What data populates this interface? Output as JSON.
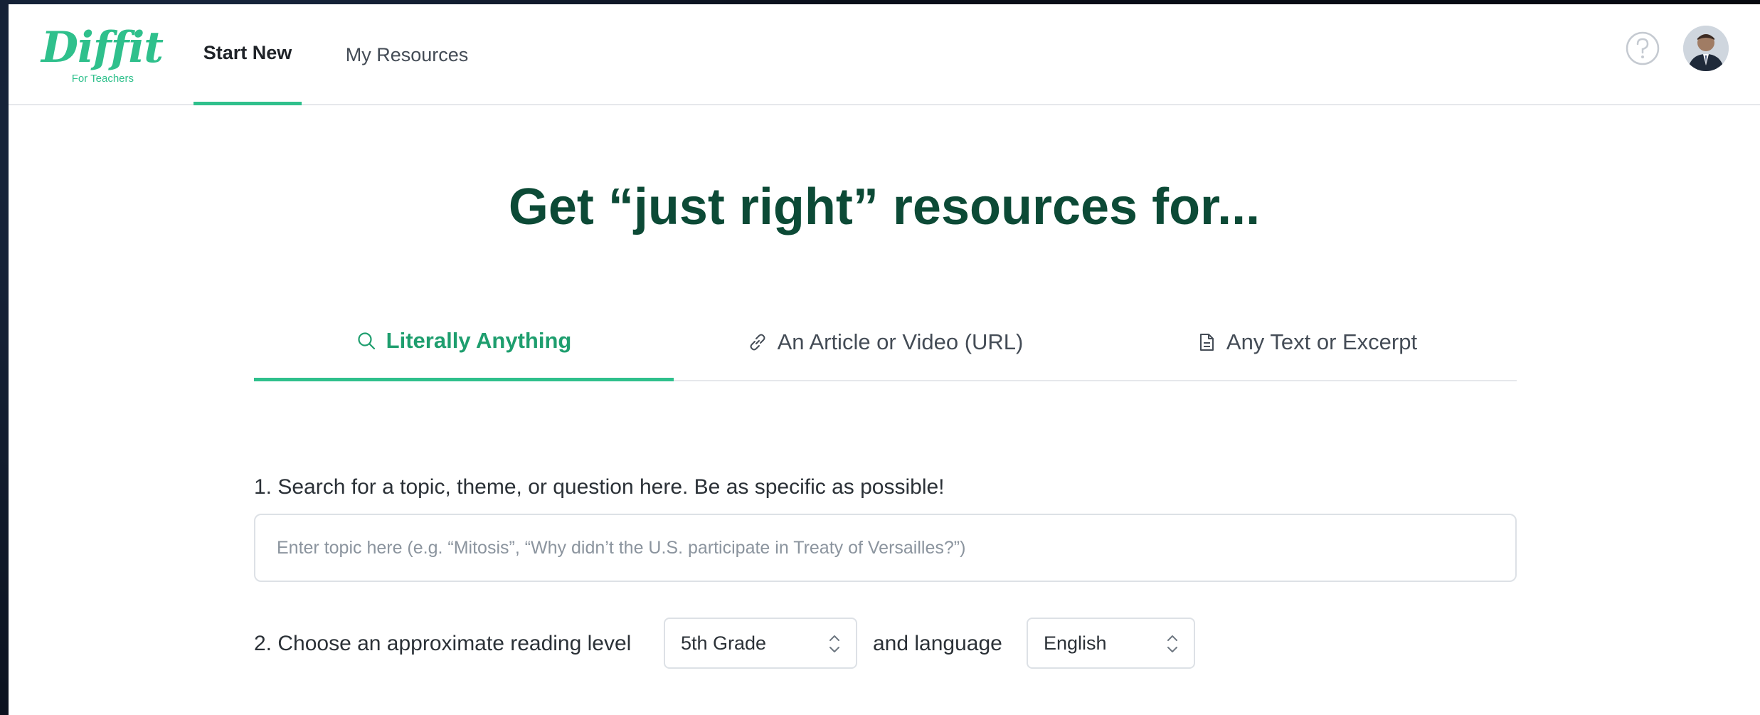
{
  "header": {
    "logo_text": "Diffit",
    "logo_subtext": "For Teachers",
    "nav": {
      "start_new": "Start New",
      "my_resources": "My Resources"
    },
    "help_icon": "help-circle-icon",
    "avatar_icon": "user-avatar"
  },
  "main": {
    "title": "Get “just right” resources for...",
    "tabs": [
      {
        "label": "Literally Anything",
        "icon": "search-icon",
        "active": true
      },
      {
        "label": "An Article or Video (URL)",
        "icon": "link-icon",
        "active": false
      },
      {
        "label": "Any Text or Excerpt",
        "icon": "document-icon",
        "active": false
      }
    ],
    "step1": {
      "label": "1. Search for a topic, theme, or question here. Be as specific as possible!",
      "placeholder": "Enter topic here (e.g. “Mitosis”, “Why didn’t the U.S. participate in Treaty of Versailles?”)",
      "value": ""
    },
    "step2": {
      "label": "2. Choose an approximate reading level",
      "reading_level": "5th Grade",
      "and_language_label": "and language",
      "language": "English"
    }
  },
  "colors": {
    "brand_green": "#2fc08c",
    "title_green": "#0c4a36",
    "active_tab_text": "#1e9e6e",
    "border": "#dde1e6"
  }
}
